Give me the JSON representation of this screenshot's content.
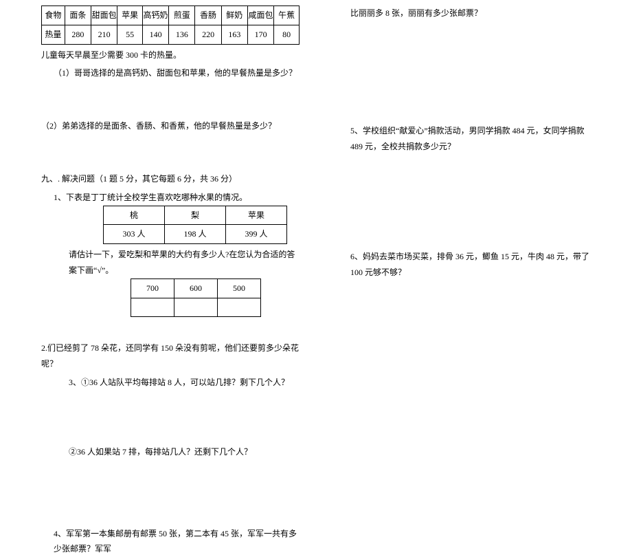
{
  "left": {
    "food_table": {
      "row_label": "食物",
      "heat_label": "热量",
      "items": [
        "面条",
        "甜面包",
        "苹果",
        "高钙奶",
        "煎蛋",
        "香肠",
        "鲜奶",
        "咸面包",
        "午蕉"
      ],
      "values": [
        "280",
        "210",
        "55",
        "140",
        "136",
        "220",
        "163",
        "170",
        "80"
      ]
    },
    "p_need": "儿童每天早晨至少需要 300 卡的热量。",
    "q_a1": "（1）哥哥选择的是高钙奶、甜面包和苹果，他的早餐热量是多少？",
    "q_a2": "（2）弟弟选择的是面条、香肠、和香蕉，他的早餐热量是多少？",
    "sec9_title": "九、. 解决问题（1 题 5 分，其它每题 6 分，共 36 分）",
    "q1_intro": "1、下表是丁丁统计全校学生喜欢吃哪种水果的情况。",
    "fruit_table": {
      "headers": [
        "桃",
        "梨",
        "苹果"
      ],
      "values": [
        "303 人",
        "198 人",
        "399 人"
      ]
    },
    "q1_est_prompt": "请估计一下，爱吃梨和苹果的大约有多少人?在您认为合适的答案下画“√”。",
    "est_table": {
      "options": [
        "700",
        "600",
        "500"
      ]
    },
    "q2": "2.们已经剪了 78 朵花，还同学有 150 朵没有剪呢，他们还要剪多少朵花呢？",
    "q3a": "3、①36 人站队平均每排站 8 人，可以站几排？剩下几个人？",
    "q3b": "②36 人如果站 7 排，每排站几人？还剩下几个人？",
    "q4": "4、军军第一本集邮册有邮票 50 张，第二本有 45 张，军军一共有多少张邮票？军军"
  },
  "right": {
    "q4_cont": "比丽丽多 8 张，丽丽有多少张邮票？",
    "q5": "5、学校组织“献爱心”捐款活动，男同学捐款 484 元，女同学捐款 489 元，全校共捐款多少元？",
    "q6": "6、妈妈去菜市场买菜，排骨 36 元，鲫鱼 15 元，牛肉 48 元，带了 100 元够不够？"
  }
}
